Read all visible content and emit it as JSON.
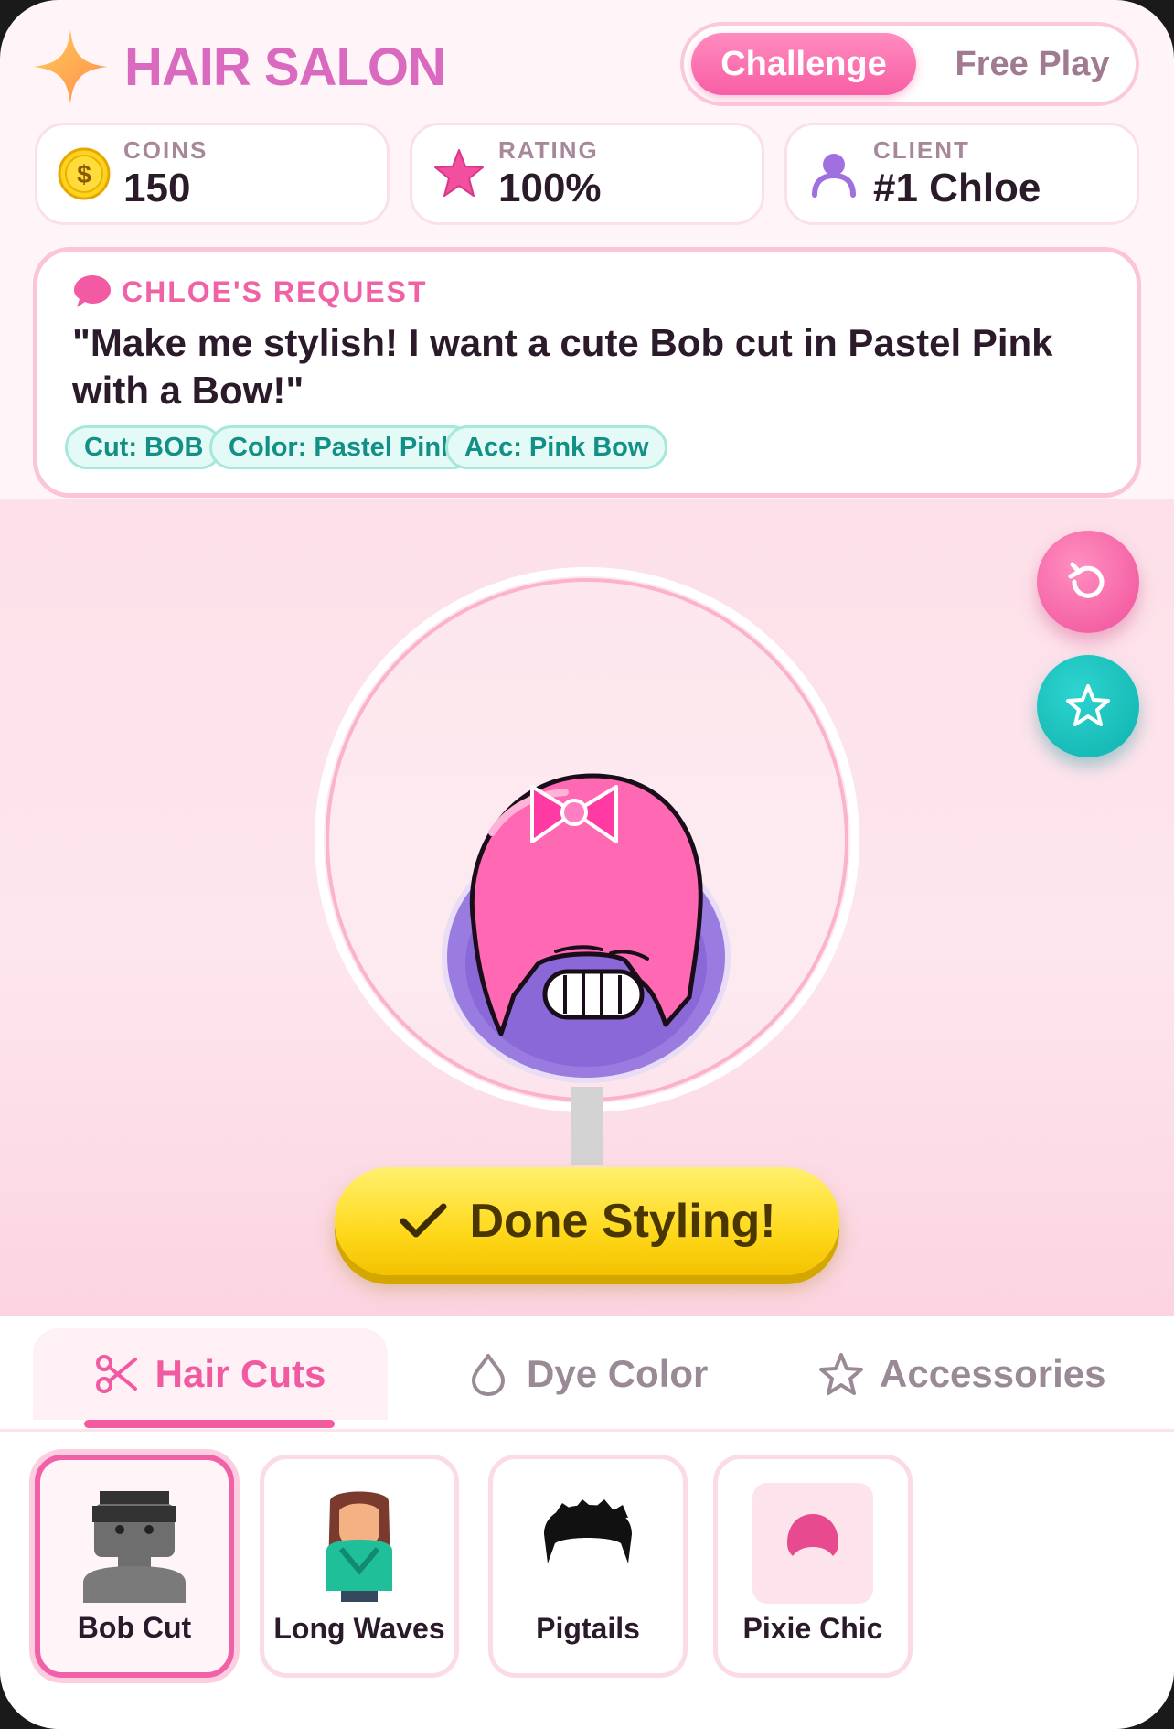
{
  "app": {
    "title": "HAIR SALON",
    "brand_icon": "sparkle-icon",
    "accent": "#f062a6",
    "title_color": "#d96ac0"
  },
  "mode": {
    "options": [
      "Challenge",
      "Free Play"
    ],
    "active": "Challenge"
  },
  "stats": {
    "coins": {
      "label": "COINS",
      "value": "150",
      "icon": "coin-icon",
      "coin_symbol": "$"
    },
    "rating": {
      "label": "RATING",
      "value": "100%",
      "icon": "star-icon"
    },
    "client": {
      "label": "CLIENT",
      "value": "#1 Chloe",
      "icon": "person-icon"
    }
  },
  "request": {
    "label": "CHLOE'S REQUEST",
    "icon": "speech-bubble-icon",
    "quote": "\"Make me stylish! I want a cute Bob cut in Pastel Pink with a Bow!\"",
    "tags": [
      "Cut: BOB",
      "Color: Pastel Pink",
      "Acc: Pink Bow"
    ]
  },
  "stage": {
    "reset_icon": "reset-icon",
    "favorite_icon": "star-outline-icon",
    "character": {
      "hair_color": "#ff69b4",
      "face_color": "#9b7be0",
      "accessory": "pink-bow"
    }
  },
  "done_button": {
    "label": "Done Styling!",
    "icon": "checkmark-icon"
  },
  "tabs": [
    {
      "label": "Hair Cuts",
      "icon": "scissors-icon",
      "active": true
    },
    {
      "label": "Dye Color",
      "icon": "droplet-icon",
      "active": false
    },
    {
      "label": "Accessories",
      "icon": "star-outline-icon",
      "active": false
    }
  ],
  "items": [
    {
      "label": "Bob Cut",
      "icon": "bob-cut-icon",
      "selected": true
    },
    {
      "label": "Long Waves",
      "icon": "long-waves-icon",
      "selected": false
    },
    {
      "label": "Pigtails",
      "icon": "pigtails-icon",
      "selected": false
    },
    {
      "label": "Pixie Chic",
      "icon": "pixie-chic-icon",
      "selected": false
    }
  ]
}
